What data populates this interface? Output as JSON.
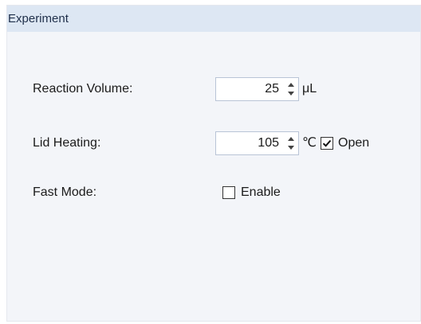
{
  "panel": {
    "title": "Experiment"
  },
  "reaction_volume": {
    "label": "Reaction Volume:",
    "value": "25",
    "unit": "μL"
  },
  "lid_heating": {
    "label": "Lid Heating:",
    "value": "105",
    "unit": "℃",
    "open_checked": true,
    "open_label": "Open"
  },
  "fast_mode": {
    "label": "Fast Mode:",
    "enable_checked": false,
    "enable_label": "Enable"
  },
  "icons": {
    "spin_up": "triangle-up",
    "spin_down": "triangle-down",
    "check": "checkmark"
  }
}
